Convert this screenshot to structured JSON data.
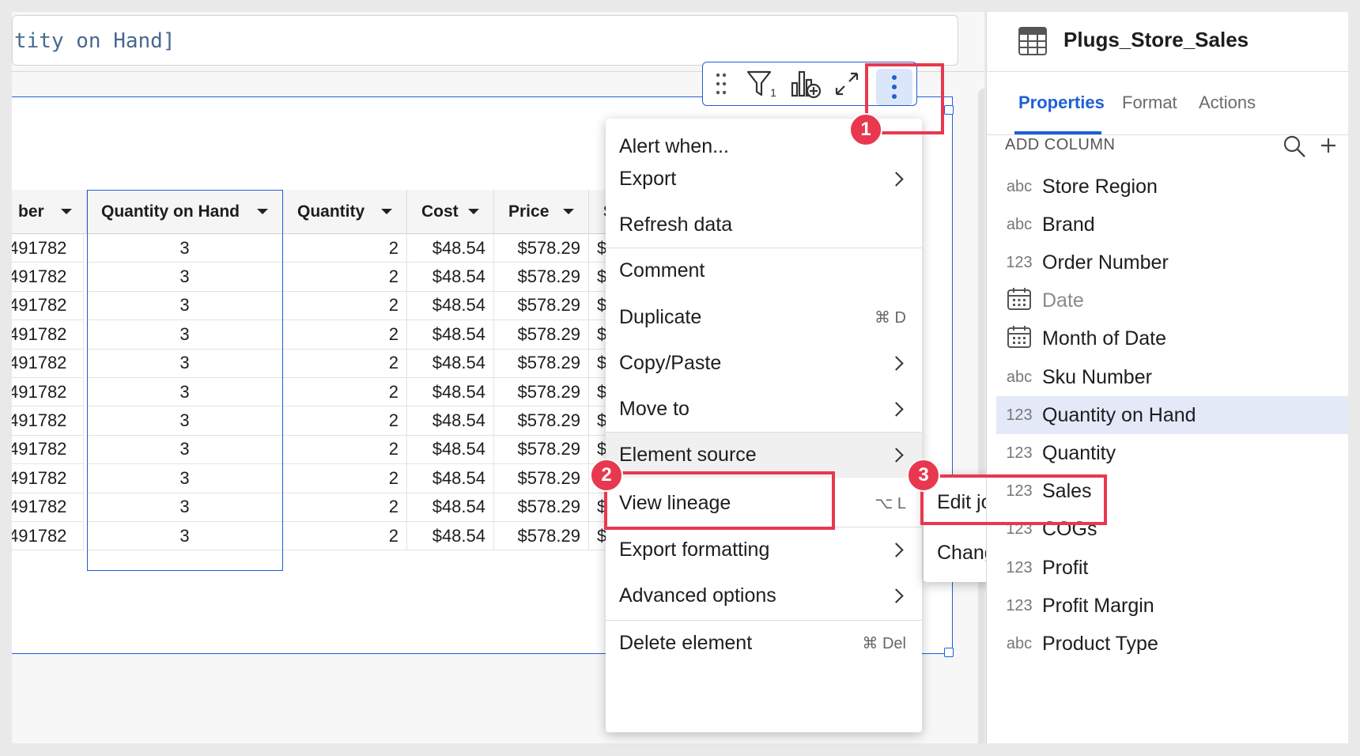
{
  "formula": {
    "text": "tity on Hand]"
  },
  "table": {
    "columns": [
      {
        "label": "ber"
      },
      {
        "label": "Quantity on Hand"
      },
      {
        "label": "Quantity"
      },
      {
        "label": "Cost"
      },
      {
        "label": "Price"
      },
      {
        "label": "S"
      }
    ],
    "rows": [
      [
        "491782",
        "3",
        "2",
        "$48.54",
        "$578.29",
        "$"
      ],
      [
        "491782",
        "3",
        "2",
        "$48.54",
        "$578.29",
        "$"
      ],
      [
        "491782",
        "3",
        "2",
        "$48.54",
        "$578.29",
        "$"
      ],
      [
        "491782",
        "3",
        "2",
        "$48.54",
        "$578.29",
        "$"
      ],
      [
        "491782",
        "3",
        "2",
        "$48.54",
        "$578.29",
        "$"
      ],
      [
        "491782",
        "3",
        "2",
        "$48.54",
        "$578.29",
        "$"
      ],
      [
        "491782",
        "3",
        "2",
        "$48.54",
        "$578.29",
        "$"
      ],
      [
        "491782",
        "3",
        "2",
        "$48.54",
        "$578.29",
        "$"
      ],
      [
        "491782",
        "3",
        "2",
        "$48.54",
        "$578.29",
        "$"
      ],
      [
        "491782",
        "3",
        "2",
        "$48.54",
        "$578.29",
        "$"
      ],
      [
        "491782",
        "3",
        "2",
        "$48.54",
        "$578.29",
        "$"
      ]
    ]
  },
  "toolbar": {
    "filter_count": "1",
    "icons": [
      "drag-handle-icon",
      "filter-icon",
      "add-chart-icon",
      "expand-icon",
      "more-vertical-icon"
    ]
  },
  "menu": {
    "items": [
      {
        "label": "Alert when...",
        "shortcut": "",
        "submenu": false
      },
      {
        "label": "Export",
        "shortcut": "",
        "submenu": true
      },
      {
        "label": "Refresh data",
        "shortcut": "",
        "submenu": false
      },
      {
        "label": "Comment",
        "shortcut": "",
        "submenu": false
      },
      {
        "label": "Duplicate",
        "shortcut": "⌘ D",
        "submenu": false
      },
      {
        "label": "Copy/Paste",
        "shortcut": "",
        "submenu": true
      },
      {
        "label": "Move to",
        "shortcut": "",
        "submenu": true
      },
      {
        "label": "Element source",
        "shortcut": "",
        "submenu": true
      },
      {
        "label": "View lineage",
        "shortcut": "⌥ L",
        "submenu": false
      },
      {
        "label": "Export formatting",
        "shortcut": "",
        "submenu": true
      },
      {
        "label": "Advanced options",
        "shortcut": "",
        "submenu": true
      },
      {
        "label": "Delete element",
        "shortcut": "⌘ Del",
        "submenu": false
      }
    ]
  },
  "submenu": {
    "items": [
      {
        "label": "Edit join..."
      },
      {
        "label": "Change source..."
      }
    ]
  },
  "panel": {
    "title": "Plugs_Store_Sales",
    "tabs": [
      "Properties",
      "Format",
      "Actions"
    ],
    "active_tab": "Properties",
    "add_column_label": "ADD COLUMN",
    "columns": [
      {
        "type": "abc",
        "name": "Store Region"
      },
      {
        "type": "abc",
        "name": "Brand"
      },
      {
        "type": "123",
        "name": "Order Number"
      },
      {
        "type": "date",
        "name": "Date"
      },
      {
        "type": "date",
        "name": "Month of Date"
      },
      {
        "type": "abc",
        "name": "Sku Number"
      },
      {
        "type": "123",
        "name": "Quantity on Hand"
      },
      {
        "type": "123",
        "name": "Quantity"
      },
      {
        "type": "123",
        "name": "Sales"
      },
      {
        "type": "123",
        "name": "COGs"
      },
      {
        "type": "123",
        "name": "Profit"
      },
      {
        "type": "123",
        "name": "Profit Margin"
      },
      {
        "type": "abc",
        "name": "Product Type"
      }
    ]
  },
  "annotations": {
    "badges": [
      "1",
      "2",
      "3"
    ]
  },
  "colors": {
    "accent": "#1f5fd4",
    "annotation": "#e8384f",
    "selected_row": "#e3e9f7"
  }
}
